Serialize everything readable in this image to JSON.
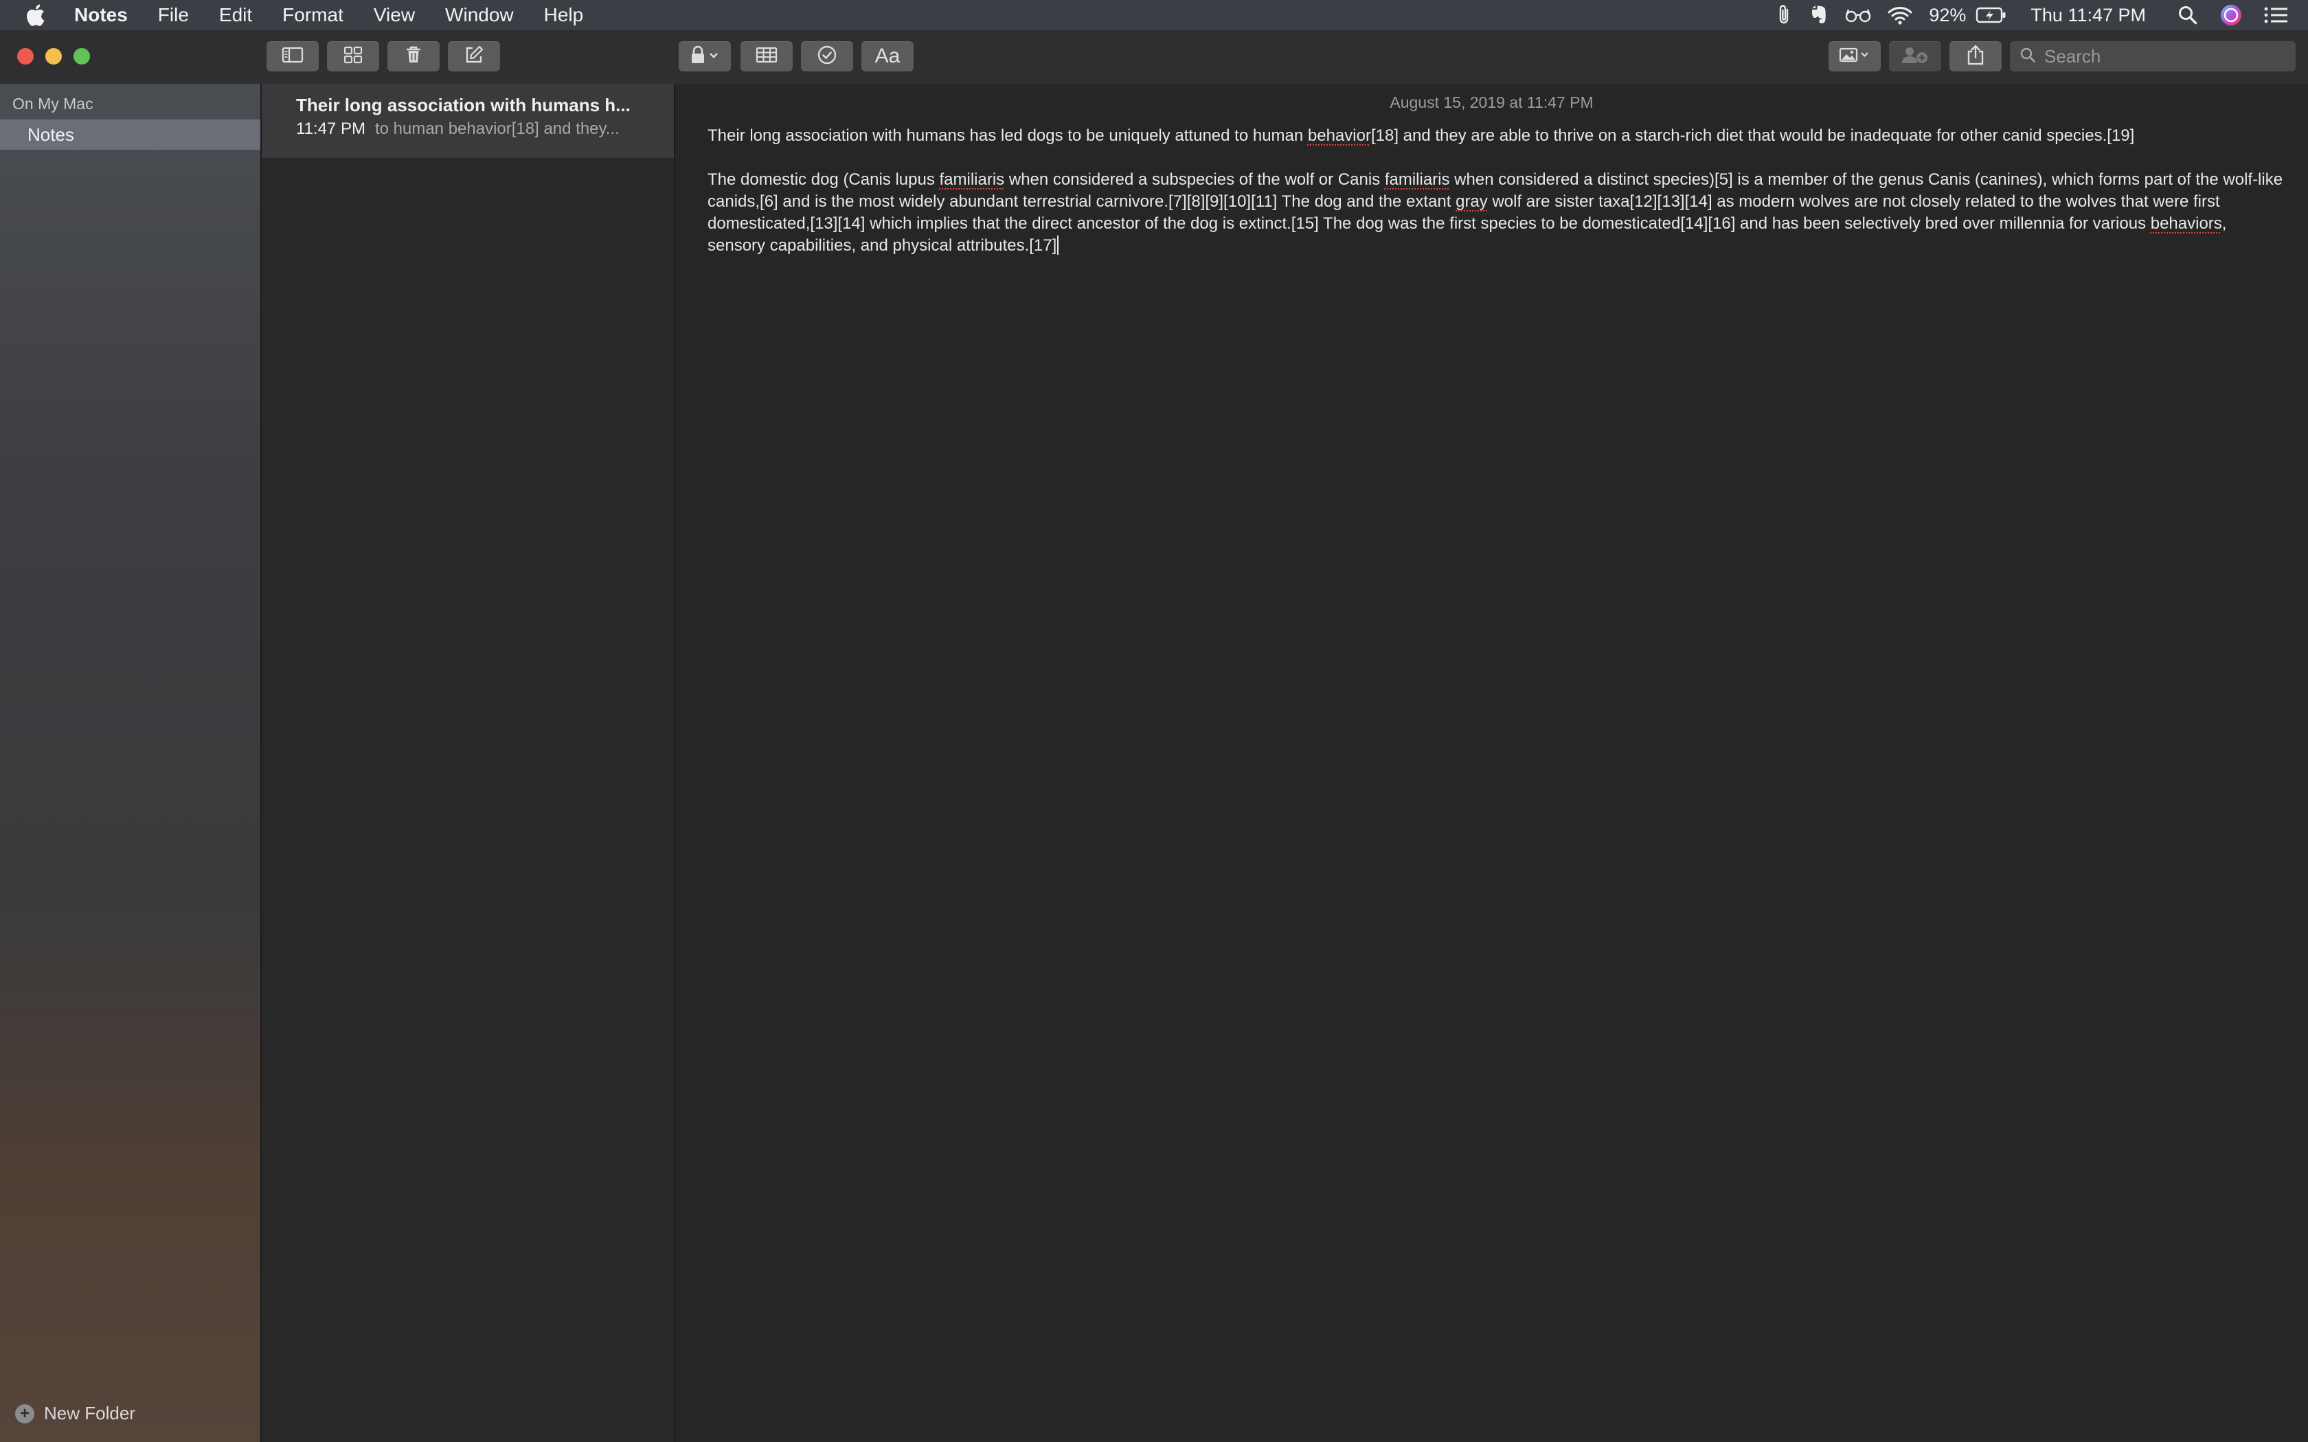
{
  "menubar": {
    "app_name": "Notes",
    "items": [
      "File",
      "Edit",
      "Format",
      "View",
      "Window",
      "Help"
    ],
    "battery": "92%",
    "clock": "Thu 11:47 PM",
    "icons": [
      "paperclip-icon",
      "evernote-icon",
      "glasses-icon",
      "wifi-icon",
      "battery-icon",
      "spotlight-icon",
      "siri-icon",
      "notification-center-icon"
    ]
  },
  "toolbar": {
    "search_placeholder": "Search",
    "format_label": "Aa"
  },
  "sidebar": {
    "section_title": "On My Mac",
    "folder": "Notes",
    "new_folder_label": "New Folder"
  },
  "notes_list": [
    {
      "title": "Their long association with humans h...",
      "time": "11:47 PM",
      "preview": "to human behavior[18] and they..."
    }
  ],
  "note": {
    "date": "August 15, 2019 at 11:47 PM",
    "p1": {
      "a": "Their long association with humans has led dogs to be uniquely attuned to human ",
      "b": "behavior",
      "c": "[18] and they are able to thrive on a starch-rich diet that would be inadequate for other canid species.[19]"
    },
    "p2": {
      "a": "The domestic dog (Canis lupus ",
      "b": "familiaris",
      "c": " when considered a subspecies of the wolf or Canis ",
      "d": "familiaris",
      "e": " when considered a distinct species)[5] is a member of the genus Canis (canines), which forms part of the wolf-like canids,[6] and is the most widely abundant terrestrial carnivore.[7][8][9][10][11] The dog and the extant ",
      "f": "gray",
      "g": " wolf are sister taxa[12][13][14] as modern wolves are not closely related to the wolves that were first domesticated,[13][14] which implies that the direct ancestor of the dog is extinct.[15] The dog was the first species to be domesticated[14][16] and has been selectively bred over millennia for various ",
      "h": "behaviors",
      "i": ", sensory capabilities, and physical attributes.[17]"
    }
  }
}
